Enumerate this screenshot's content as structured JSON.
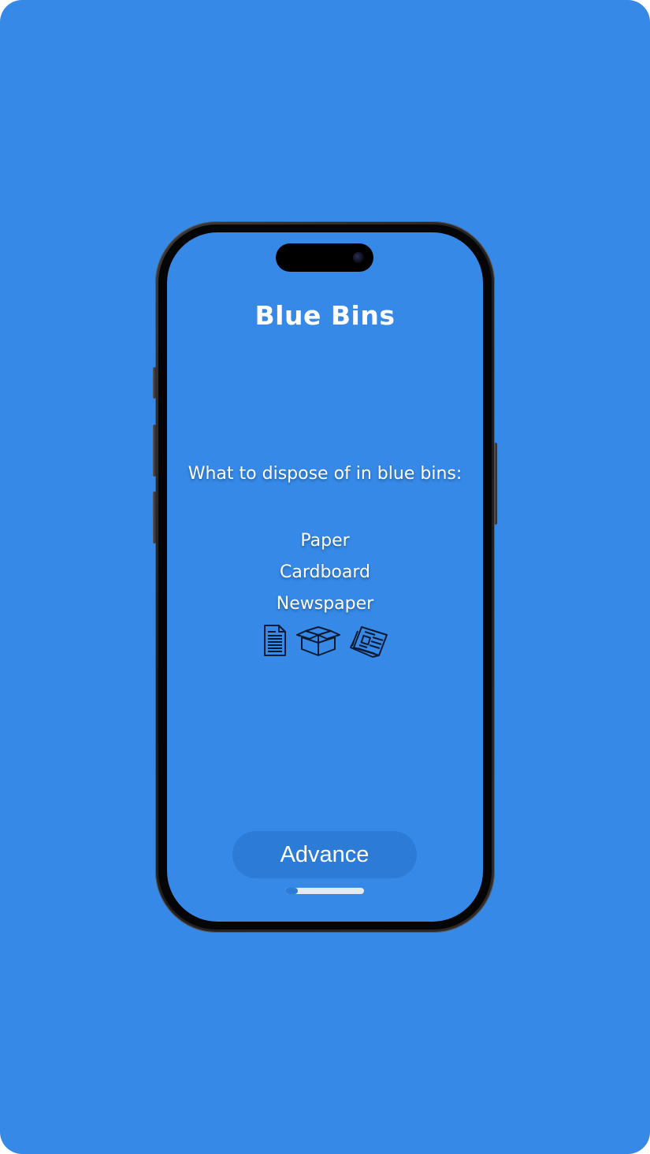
{
  "colors": {
    "background": "#3689e6",
    "screen": "#3689e6",
    "button": "#2c7bd6",
    "progress_fill": "#2c7bd6"
  },
  "screen": {
    "title": "Blue Bins",
    "subtitle": "What to dispose of in blue bins:",
    "items": [
      "Paper",
      "Cardboard",
      "Newspaper"
    ],
    "icons": [
      "document-icon",
      "open-box-icon",
      "newspaper-icon"
    ],
    "advance_label": "Advance",
    "progress": 0.16
  }
}
